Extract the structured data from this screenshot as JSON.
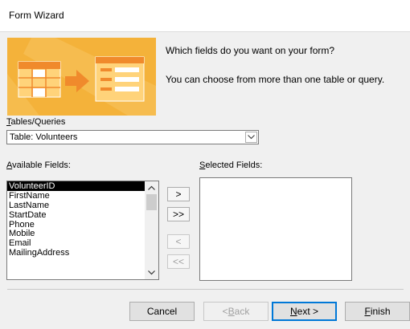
{
  "window": {
    "title": "Form Wizard"
  },
  "banner": {
    "icon": "form-wizard-illustration",
    "color": "#f4b23a"
  },
  "prompt": {
    "question": "Which fields do you want on your form?",
    "hint": "You can choose from more than one table or query."
  },
  "tables_queries": {
    "label_u": "T",
    "label_rest": "ables/Queries",
    "selected": "Table: Volunteers"
  },
  "available": {
    "label_u": "A",
    "label_rest": "vailable Fields:",
    "items": [
      "VolunteerID",
      "FirstName",
      "LastName",
      "StartDate",
      "Phone",
      "Mobile",
      "Email",
      "MailingAddress"
    ],
    "selected_index": 0
  },
  "selected_fields": {
    "label_u": "S",
    "label_rest": "elected Fields:",
    "items": []
  },
  "move_buttons": {
    "add_one": ">",
    "add_all": ">>",
    "remove_one": "<",
    "remove_all": "<<"
  },
  "footer": {
    "cancel": "Cancel",
    "back_u": "B",
    "back_pre": "< ",
    "back_rest": "ack",
    "next_u": "N",
    "next_rest": "ext >",
    "finish_u": "F",
    "finish_rest": "inish"
  }
}
